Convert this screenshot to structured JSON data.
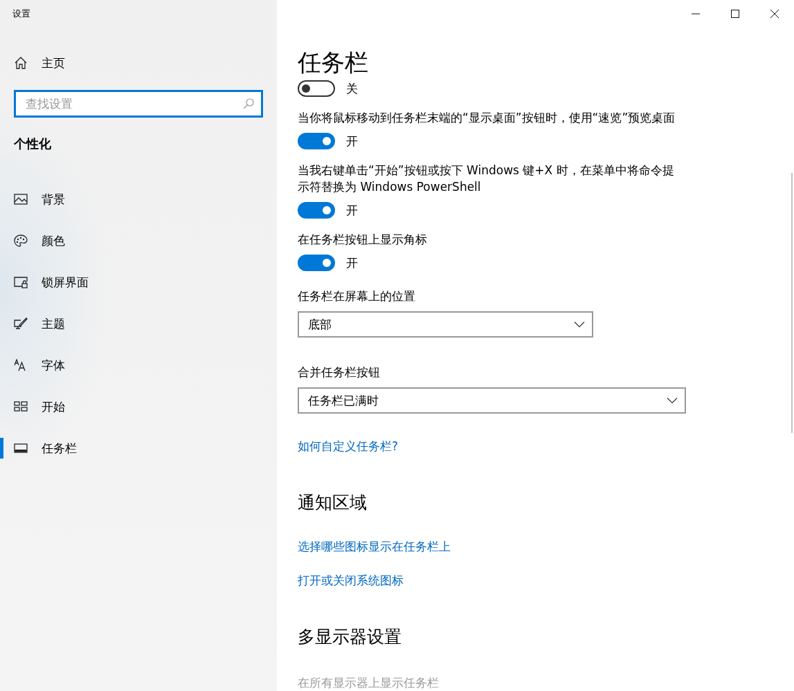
{
  "window": {
    "title": "设置"
  },
  "sidebar": {
    "home": {
      "label": "主页"
    },
    "search": {
      "placeholder": "查找设置",
      "focused": true
    },
    "section": "个性化",
    "items": [
      {
        "kind": "picture",
        "label": "背景",
        "selected": false
      },
      {
        "kind": "palette",
        "label": "颜色",
        "selected": false
      },
      {
        "kind": "lock",
        "label": "锁屏界面",
        "selected": false
      },
      {
        "kind": "theme",
        "label": "主题",
        "selected": false
      },
      {
        "kind": "font",
        "label": "字体",
        "selected": false
      },
      {
        "kind": "start",
        "label": "开始",
        "selected": false
      },
      {
        "kind": "taskbar",
        "label": "任务栏",
        "selected": true
      }
    ]
  },
  "main": {
    "title": "任务栏",
    "settings": [
      {
        "kind": "toggle",
        "on": false,
        "state": "关"
      },
      {
        "kind": "toggle",
        "label": "当你将鼠标移动到任务栏末端的“显示桌面”按钮时，使用“速览”预览桌面",
        "on": true,
        "state": "开"
      },
      {
        "kind": "toggle",
        "label": "当我右键单击“开始”按钮或按下 Windows 键+X 时，在菜单中将命令提示符替换为 Windows PowerShell",
        "on": true,
        "state": "开"
      },
      {
        "kind": "toggle",
        "label": "在任务栏按钮上显示角标",
        "on": true,
        "state": "开"
      },
      {
        "kind": "dropdown",
        "label": "任务栏在屏幕上的位置",
        "value": "底部"
      },
      {
        "kind": "dropdown",
        "label": "合并任务栏按钮",
        "value": "任务栏已满时"
      },
      {
        "kind": "link",
        "label": "如何自定义任务栏?"
      },
      {
        "kind": "heading",
        "label": "通知区域"
      },
      {
        "kind": "link",
        "label": "选择哪些图标显示在任务栏上"
      },
      {
        "kind": "link",
        "label": "打开或关闭系统图标"
      },
      {
        "kind": "heading",
        "label": "多显示器设置"
      },
      {
        "kind": "text",
        "label": "在所有显示器上显示任务栏",
        "disabled": true
      }
    ]
  }
}
